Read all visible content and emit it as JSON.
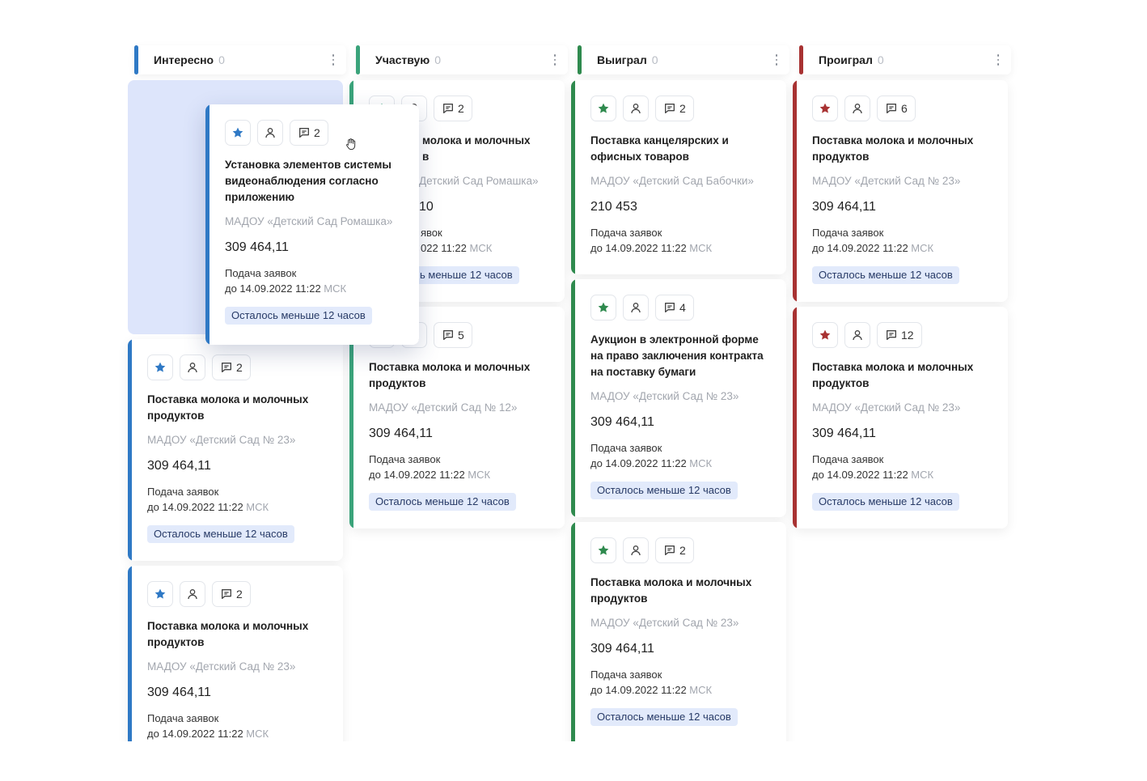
{
  "colors": {
    "interesting": "#2f79c5",
    "participate": "#3aa37a",
    "won": "#2f8a4e",
    "lost": "#a83232",
    "badge_bg": "#e2eafb"
  },
  "columns": [
    {
      "title": "Интересно",
      "count": "0"
    },
    {
      "title": "Участвую",
      "count": "0"
    },
    {
      "title": "Выиграл",
      "count": "0"
    },
    {
      "title": "Проиграл",
      "count": "0"
    }
  ],
  "deadline_label": "Подача заявок",
  "deadline_prefix": "до 14.09.2022 11:22",
  "tz": "МСК",
  "badge": "Осталось меньше 12 часов",
  "cards": {
    "lifted": {
      "comments": "2",
      "title": "Установка элементов системы видеонаблюдения согласно приложению",
      "org": "МАДОУ «Детский Сад Ромашка»",
      "price": "309 464,11"
    },
    "c1_a": {
      "comments": "2",
      "title": "Поставка молока и молочных продуктов",
      "org": "МАДОУ «Детский Сад  № 23»",
      "price": "309 464,11"
    },
    "c1_b": {
      "comments": "2",
      "title": "Поставка молока и молочных продуктов",
      "org": "МАДОУ «Детский Сад  № 23»",
      "price": "309 464,11"
    },
    "c2_a": {
      "comments": "2",
      "title_line1": "молока и молочных",
      "title_line2": "в",
      "org": "Детский Сад Ромашка»",
      "price": "10",
      "deadline_label": "явок",
      "deadline": "022 11:22",
      "badge": "ь меньше 12 часов"
    },
    "c2_b": {
      "comments": "5",
      "title": "Поставка молока и молочных продуктов",
      "org": "МАДОУ «Детский Сад  № 12»",
      "price": "309 464,11"
    },
    "c3_a": {
      "comments": "2",
      "title": "Поставка канцелярских и офисных товаров",
      "org": "МАДОУ «Детский Сад Бабочки»",
      "price": "210 453"
    },
    "c3_b": {
      "comments": "4",
      "title": "Аукцион в электронной форме на право заключения контракта на поставку бумаги",
      "org": "МАДОУ «Детский Сад  № 23»",
      "price": "309 464,11"
    },
    "c3_c": {
      "comments": "2",
      "title": "Поставка молока и молочных продуктов",
      "org": "МАДОУ «Детский Сад  № 23»",
      "price": "309 464,11"
    },
    "c4_a": {
      "comments": "6",
      "title": "Поставка молока и молочных продуктов",
      "org": "МАДОУ «Детский Сад  № 23»",
      "price": "309 464,11"
    },
    "c4_b": {
      "comments": "12",
      "title": "Поставка молока и молочных продуктов",
      "org": "МАДОУ «Детский Сад  № 23»",
      "price": "309 464,11"
    }
  }
}
